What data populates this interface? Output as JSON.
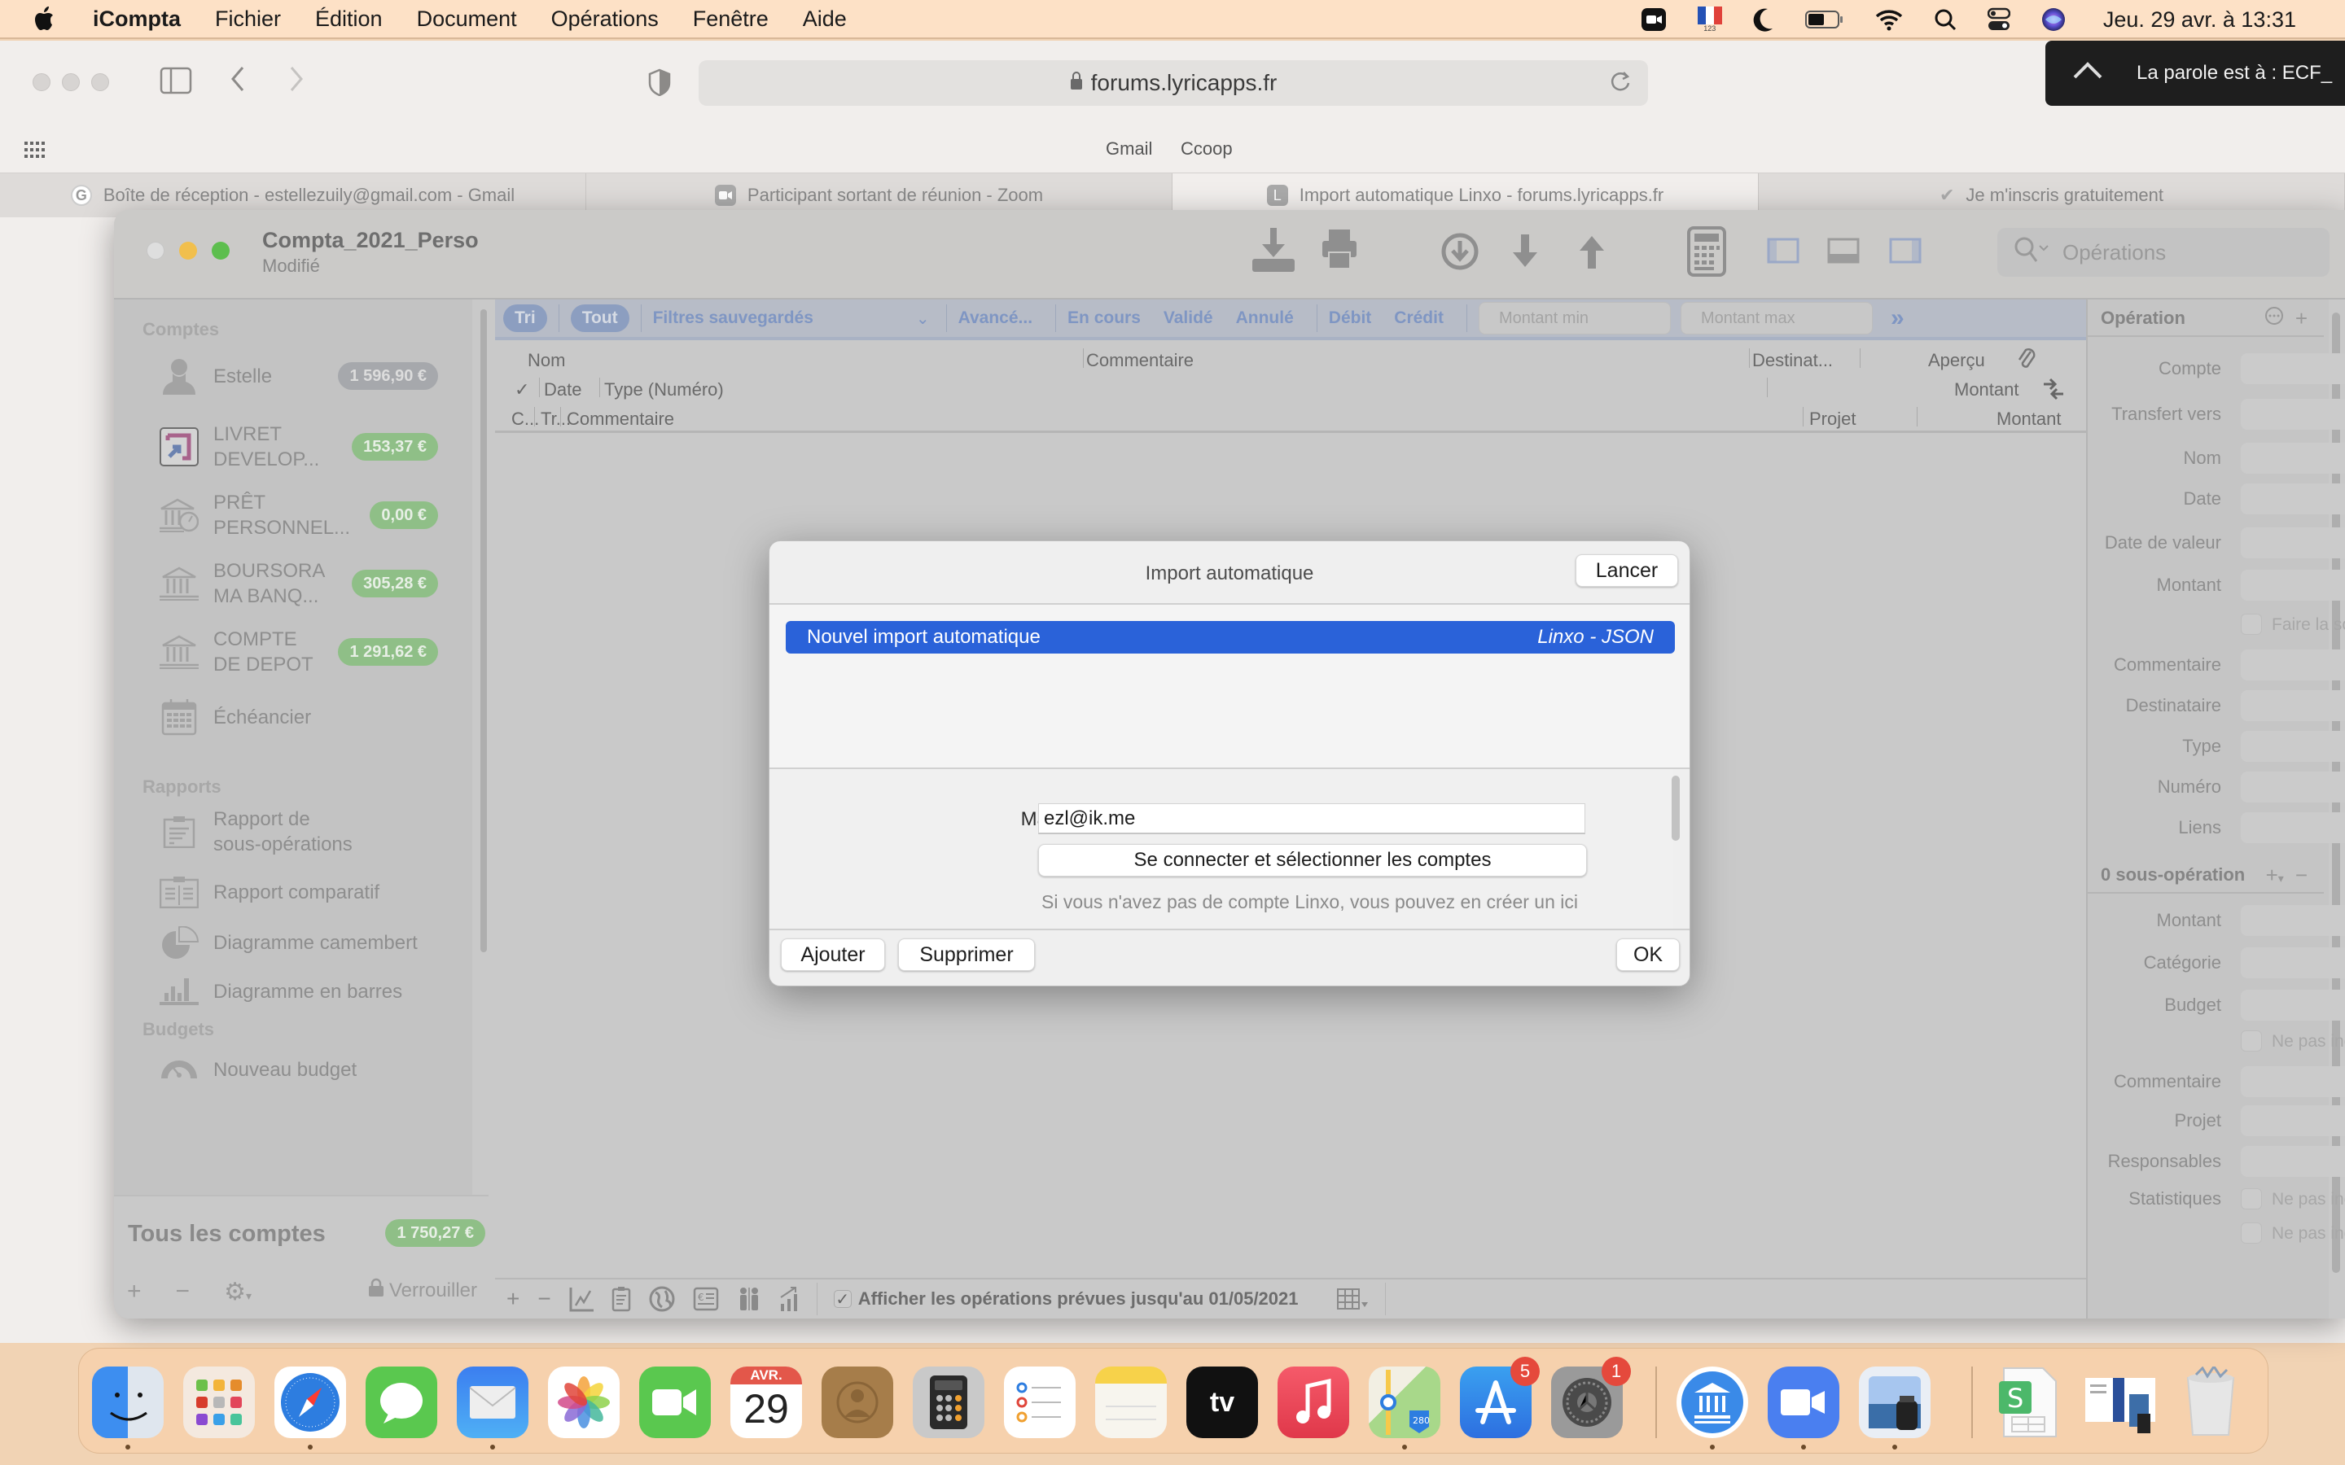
{
  "menubar": {
    "app_name": "iCompta",
    "items": [
      "Fichier",
      "Édition",
      "Document",
      "Opérations",
      "Fenêtre",
      "Aide"
    ],
    "input_source_label": "123",
    "clock": "Jeu. 29 avr. à  13:31"
  },
  "zoom_banner": {
    "text": "La parole est à : ECF_"
  },
  "safari": {
    "url": "forums.lyricapps.fr",
    "favorites": [
      "Gmail",
      "Ccoop"
    ],
    "tabs": [
      {
        "title": "Boîte de réception - estellezuily@gmail.com - Gmail",
        "favicon": "G",
        "active": false
      },
      {
        "title": "Participant sortant de réunion - Zoom",
        "favicon": "zoom",
        "active": false
      },
      {
        "title": "Import automatique Linxo - forums.lyricapps.fr",
        "favicon": "L",
        "active": true
      },
      {
        "title": "Je m'inscris gratuitement",
        "favicon": "check",
        "active": false
      }
    ]
  },
  "window": {
    "title": "Compta_2021_Perso",
    "subtitle": "Modifié",
    "search_placeholder": "Opérations"
  },
  "sidebar": {
    "sections": {
      "accounts": "Comptes",
      "reports": "Rapports",
      "budgets": "Budgets"
    },
    "accounts": [
      {
        "name": "Estelle",
        "balance": "1 596,90 €",
        "icon": "person-icon",
        "badge": "gray"
      },
      {
        "name": "LIVRET DEVELOP...",
        "line1": "LIVRET",
        "line2": "DEVELOP...",
        "balance": "153,37 €",
        "icon": "savings-icon",
        "badge": "green"
      },
      {
        "name": "PRÊT PERSONNEL...",
        "line1": "PRÊT",
        "line2": "PERSONNEL...",
        "balance": "0,00 €",
        "icon": "loan-bank-icon",
        "badge": "green"
      },
      {
        "name": "BOURSORA MA BANQ...",
        "line1": "BOURSORA",
        "line2": "MA BANQ...",
        "balance": "305,28 €",
        "icon": "bank-icon",
        "badge": "green"
      },
      {
        "name": "COMPTE DE DEPOT",
        "line1": "COMPTE",
        "line2": "DE DEPOT",
        "balance": "1 291,62 €",
        "icon": "bank-icon",
        "badge": "green"
      }
    ],
    "scheduler": "Échéancier",
    "reports": [
      {
        "line1": "Rapport de",
        "line2": "sous-opérations",
        "icon": "clipboard-icon"
      },
      {
        "label": "Rapport comparatif",
        "icon": "compare-report-icon"
      },
      {
        "label": "Diagramme camembert",
        "icon": "pie-chart-icon"
      },
      {
        "label": "Diagramme en barres",
        "icon": "bar-chart-icon"
      }
    ],
    "budgets": [
      {
        "label": "Nouveau budget",
        "icon": "gauge-icon"
      }
    ],
    "total_label": "Tous les comptes",
    "total_balance": "1 750,27 €",
    "lock_label": "Verrouiller"
  },
  "filterbar": {
    "sort": "Tri",
    "all": "Tout",
    "saved_filters": "Filtres sauvegardés",
    "advanced": "Avancé...",
    "status_filters": [
      "En cours",
      "Validé",
      "Annulé"
    ],
    "type_filters": [
      "Débit",
      "Crédit"
    ],
    "min_placeholder": "Montant min",
    "max_placeholder": "Montant max"
  },
  "columns": {
    "row1": {
      "name": "Nom",
      "comment": "Commentaire",
      "recipient": "Destinat...",
      "preview": "Aperçu"
    },
    "row2": {
      "check": "✓",
      "date": "Date",
      "type": "Type (Numéro)",
      "amount": "Montant"
    },
    "row3": {
      "category": "C...",
      "transfer": "Tr...",
      "comment": "Commentaire",
      "project": "Projet",
      "amount": "Montant"
    }
  },
  "main_bottom": {
    "forecast_checked": true,
    "forecast_label": "Afficher les opérations prévues jusqu'au 01/05/2021"
  },
  "operation_panel": {
    "title": "Opération",
    "fields": [
      "Compte",
      "Transfert vers",
      "Nom",
      "Date",
      "Date de valeur",
      "Montant"
    ],
    "sum_checkbox": "Faire la somme...",
    "fields2": [
      "Commentaire",
      "Destinataire",
      "Type",
      "Numéro",
      "Liens"
    ],
    "sub_title": "0 sous-opération",
    "sub_fields": [
      "Montant",
      "Catégorie",
      "Budget"
    ],
    "budget_checkbox": "Ne pas inclure d...",
    "sub_fields2": [
      "Commentaire",
      "Projet",
      "Responsables"
    ],
    "stats_label": "Statistiques",
    "stats_checks": [
      "Ne pas inclure d...",
      "Ne pas inclure lo..."
    ]
  },
  "dialog": {
    "title": "Import automatique",
    "launch_button": "Lancer",
    "imports": [
      {
        "name": "Nouvel import automatique",
        "type": "Linxo - JSON",
        "selected": true
      }
    ],
    "mail_label": "Mail :",
    "mail_value": "ezl@ik.me",
    "connect_button": "Se connecter et sélectionner les comptes",
    "hint": "Si vous n'avez pas de compte Linxo, vous pouvez en créer un ici",
    "add_button": "Ajouter",
    "delete_button": "Supprimer",
    "ok_button": "OK"
  },
  "dock": {
    "calendar_month": "AVR.",
    "calendar_day": "29",
    "apps": [
      "Finder",
      "Launchpad",
      "Safari",
      "Messages",
      "Mail",
      "Photos",
      "FaceTime",
      "Calendrier",
      "Contacts",
      "Calculette",
      "Rappels",
      "Notes",
      "TV",
      "Musique",
      "Plans",
      "App Store",
      "Préférences Système",
      "iCompta",
      "Zoom",
      "Aperçu",
      "Numbers document",
      "Document preview",
      "Corbeille"
    ],
    "badges": {
      "app_store": "5",
      "system_prefs": "1"
    }
  }
}
